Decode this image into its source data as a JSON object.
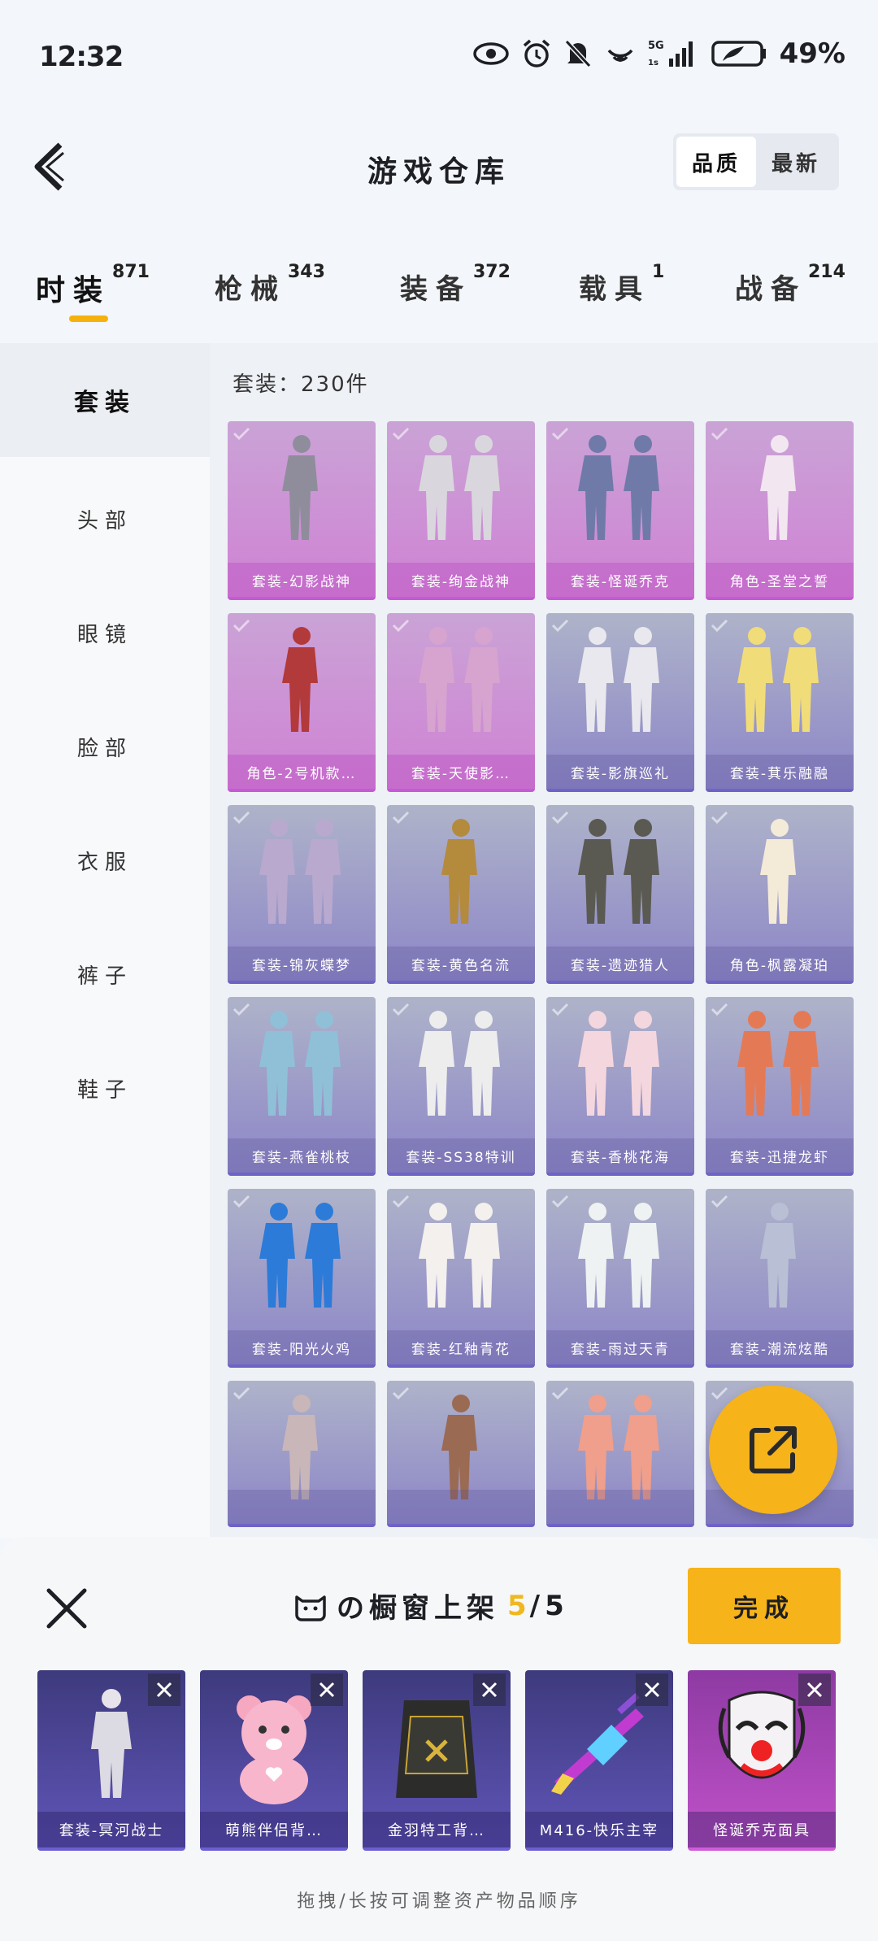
{
  "status": {
    "time": "12:32",
    "network": "5G",
    "battery": "49%"
  },
  "header": {
    "title": "游戏仓库",
    "sort_options": [
      "品质",
      "最新"
    ],
    "active_sort": 0
  },
  "categories": [
    {
      "label": "时装",
      "count": "871",
      "active": true
    },
    {
      "label": "枪械",
      "count": "343"
    },
    {
      "label": "装备",
      "count": "372"
    },
    {
      "label": "载具",
      "count": "1"
    },
    {
      "label": "战备",
      "count": "214"
    }
  ],
  "sidebar": {
    "items": [
      "套装",
      "头部",
      "眼镜",
      "脸部",
      "衣服",
      "裤子",
      "鞋子"
    ],
    "active": 0
  },
  "grid": {
    "count_label": "套装：230件",
    "items": [
      {
        "name": "套装-幻影战神",
        "quality": "pink"
      },
      {
        "name": "套装-绚金战神",
        "quality": "pink"
      },
      {
        "name": "套装-怪诞乔克",
        "quality": "pink"
      },
      {
        "name": "角色-圣堂之誓",
        "quality": "pink"
      },
      {
        "name": "角色-2号机款…",
        "quality": "pink"
      },
      {
        "name": "套装-天使影…",
        "quality": "pink"
      },
      {
        "name": "套装-影旗巡礼",
        "quality": "purple"
      },
      {
        "name": "套装-萁乐融融",
        "quality": "purple"
      },
      {
        "name": "套装-锦灰蝶梦",
        "quality": "purple"
      },
      {
        "name": "套装-黄色名流",
        "quality": "purple"
      },
      {
        "name": "套装-遗迹猎人",
        "quality": "purple"
      },
      {
        "name": "角色-枫露凝珀",
        "quality": "purple"
      },
      {
        "name": "套装-燕雀桃枝",
        "quality": "purple"
      },
      {
        "name": "套装-SS38特训",
        "quality": "purple"
      },
      {
        "name": "套装-香桃花海",
        "quality": "purple"
      },
      {
        "name": "套装-迅捷龙虾",
        "quality": "purple"
      },
      {
        "name": "套装-阳光火鸡",
        "quality": "purple"
      },
      {
        "name": "套装-红釉青花",
        "quality": "purple"
      },
      {
        "name": "套装-雨过天青",
        "quality": "purple"
      },
      {
        "name": "套装-潮流炫酷",
        "quality": "purple"
      },
      {
        "name": "",
        "quality": "purple"
      },
      {
        "name": "",
        "quality": "purple"
      },
      {
        "name": "",
        "quality": "purple"
      },
      {
        "name": "",
        "quality": "purple"
      }
    ]
  },
  "sheet": {
    "title": "の橱窗上架",
    "count_current": "5",
    "count_total": "/5",
    "done_label": "完成",
    "items": [
      {
        "name": "套装-冥河战士",
        "quality": "purple"
      },
      {
        "name": "萌熊伴侣背…",
        "quality": "purple"
      },
      {
        "name": "金羽特工背…",
        "quality": "purple"
      },
      {
        "name": "M416-快乐主宰",
        "quality": "purple"
      },
      {
        "name": "怪诞乔克面具",
        "quality": "pink"
      }
    ],
    "hint": "拖拽/长按可调整资产物品顺序"
  }
}
